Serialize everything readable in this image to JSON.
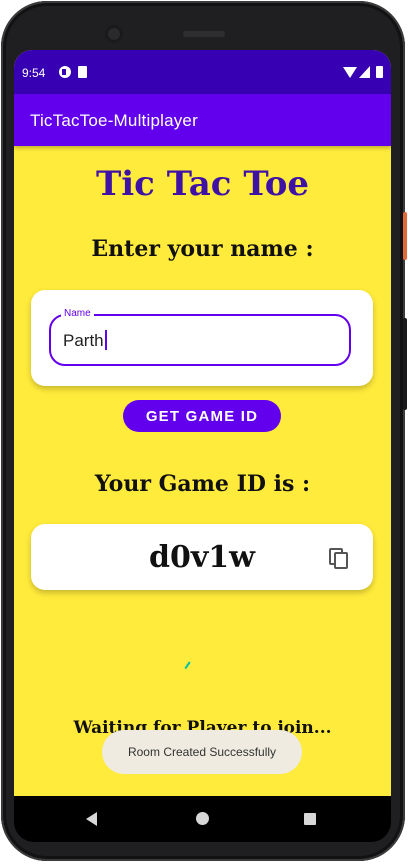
{
  "status_bar": {
    "time": "9:54",
    "icons": [
      "app-notification-icon",
      "sd-card-icon",
      "wifi-icon",
      "signal-icon",
      "battery-icon"
    ]
  },
  "app_bar": {
    "title": "TicTacToe-Multiplayer",
    "color": "#6200ee"
  },
  "main": {
    "title": "Tic Tac Toe",
    "name_prompt": "Enter your name :",
    "name_field": {
      "label": "Name",
      "value": "Parth"
    },
    "get_id_button": "GET GAME ID",
    "game_id_prompt": "Your Game ID is :",
    "game_id": "d0v1w",
    "copy_icon": "copy-icon",
    "waiting_text": "Waiting for Player to join..."
  },
  "toast": "Room Created Successfully",
  "nav_bar": {
    "icons": [
      "back-icon",
      "home-icon",
      "recents-icon"
    ]
  },
  "colors": {
    "background": "#ffeb3b",
    "accent": "#6200ee",
    "status_bar": "#3700b3",
    "title": "#3f12a6"
  }
}
